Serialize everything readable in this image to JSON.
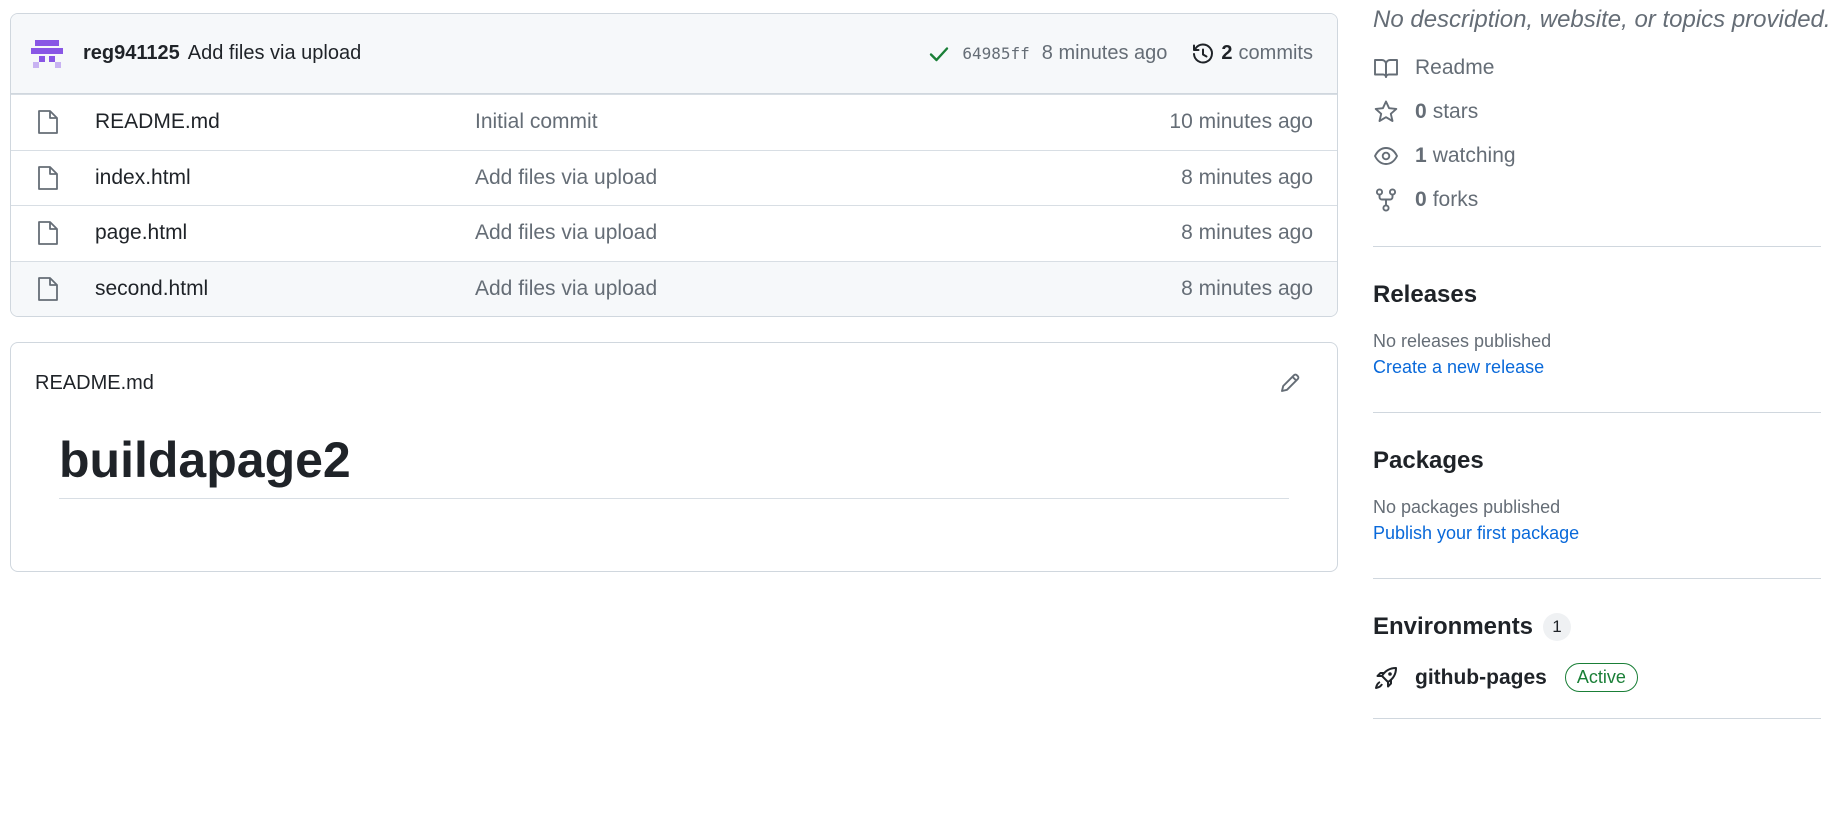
{
  "commit": {
    "author": "reg941125",
    "message": "Add files via upload",
    "sha": "64985ff",
    "time": "8 minutes ago",
    "count": "2",
    "count_label": "commits"
  },
  "files": [
    {
      "name": "README.md",
      "commit": "Initial commit",
      "age": "10 minutes ago"
    },
    {
      "name": "index.html",
      "commit": "Add files via upload",
      "age": "8 minutes ago"
    },
    {
      "name": "page.html",
      "commit": "Add files via upload",
      "age": "8 minutes ago"
    },
    {
      "name": "second.html",
      "commit": "Add files via upload",
      "age": "8 minutes ago"
    }
  ],
  "readme": {
    "filename": "README.md",
    "heading": "buildapage2"
  },
  "about": {
    "description": "No description, website, or topics provided.",
    "readme_label": "Readme",
    "stars_count": "0",
    "stars_label": "stars",
    "watching_count": "1",
    "watching_label": "watching",
    "forks_count": "0",
    "forks_label": "forks"
  },
  "releases": {
    "title": "Releases",
    "empty": "No releases published",
    "link": "Create a new release"
  },
  "packages": {
    "title": "Packages",
    "empty": "No packages published",
    "link": "Publish your first package"
  },
  "environments": {
    "title": "Environments",
    "count": "1",
    "items": [
      {
        "name": "github-pages",
        "status": "Active"
      }
    ]
  },
  "colors": {
    "accent_link": "#0969da",
    "success": "#1a7f37",
    "avatar": "#8957e5",
    "muted": "#656d76"
  },
  "icons": {
    "avatar": "identicon-avatar",
    "status": "check-icon",
    "history": "history-icon",
    "file": "file-icon",
    "edit": "pencil-icon",
    "readme": "book-icon",
    "stars": "star-icon",
    "watching": "eye-icon",
    "forks": "fork-icon",
    "environment": "rocket-icon"
  }
}
